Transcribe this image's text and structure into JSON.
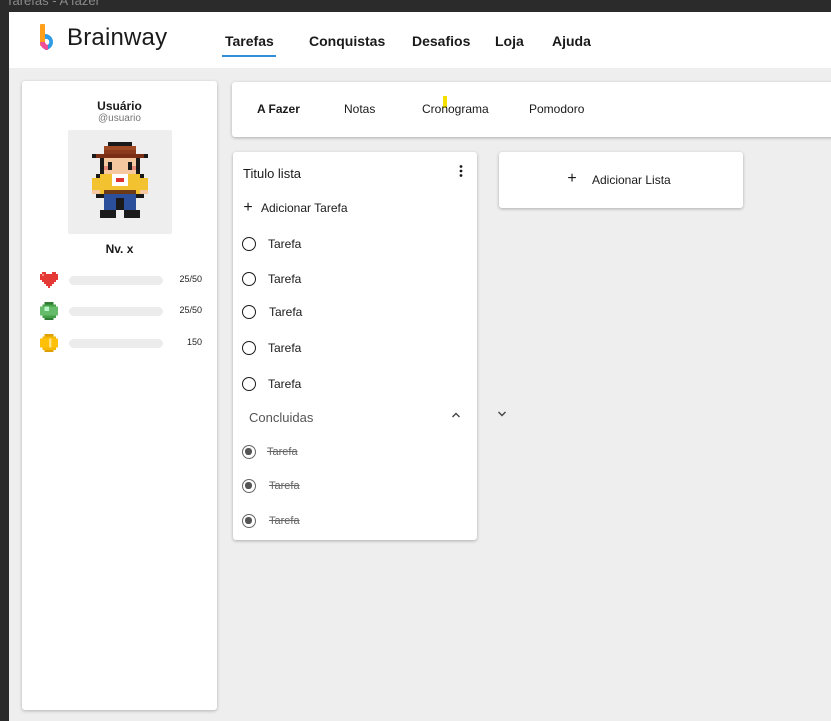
{
  "window": {
    "title": "Tarefas - A fazer"
  },
  "brand": {
    "name": "Brainway",
    "colors": [
      "#ff9f1a",
      "#f04e98",
      "#2e9be6"
    ]
  },
  "nav": {
    "items": [
      {
        "label": "Tarefas",
        "active": true
      },
      {
        "label": "Conquistas"
      },
      {
        "label": "Desafios"
      },
      {
        "label": "Loja"
      },
      {
        "label": "Ajuda"
      }
    ],
    "accent": "#2f8fd8"
  },
  "profile": {
    "name": "Usuário",
    "handle": "@usuario",
    "level": "Nv. x",
    "stats": [
      {
        "icon": "heart-icon",
        "value": "25/50"
      },
      {
        "icon": "gem-icon",
        "value": "25/50"
      },
      {
        "icon": "coin-icon",
        "value": "150"
      }
    ]
  },
  "tabs": [
    {
      "label": "A Fazer",
      "active": true
    },
    {
      "label": "Notas"
    },
    {
      "label": "Cronograma"
    },
    {
      "label": "Pomodoro"
    }
  ],
  "list": {
    "title": "Titulo lista",
    "add_task_label": "Adicionar Tarefa",
    "tasks": [
      "Tarefa",
      "Tarefa",
      "Tarefa",
      "Tarefa",
      "Tarefa"
    ],
    "done_header": "Concluidas",
    "done_tasks": [
      "Tarefa",
      "Tarefa",
      "Tarefa"
    ]
  },
  "add_list": {
    "label": "Adicionar Lista"
  }
}
